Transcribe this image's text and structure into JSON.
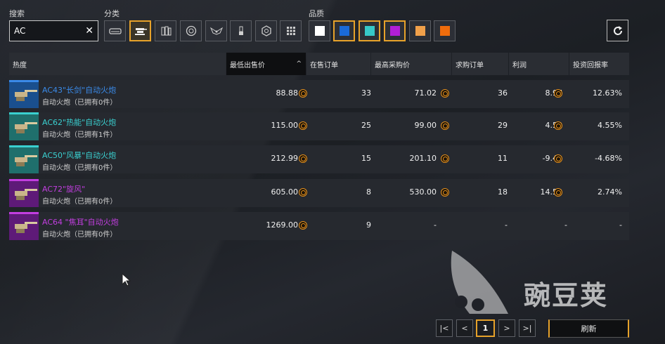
{
  "labels": {
    "search": "搜索",
    "category": "分类",
    "quality": "品质"
  },
  "search": {
    "value": "AC",
    "clear_icon": "close-icon"
  },
  "categories": [
    {
      "icon": "vehicle-icon",
      "active": false
    },
    {
      "icon": "autocannon-icon",
      "active": true
    },
    {
      "icon": "ammo-rack-icon",
      "active": false
    },
    {
      "icon": "wheel-icon",
      "active": false
    },
    {
      "icon": "wings-icon",
      "active": false
    },
    {
      "icon": "brush-icon",
      "active": false
    },
    {
      "icon": "module-icon",
      "active": false
    },
    {
      "icon": "grid-icon",
      "active": false
    }
  ],
  "qualities": [
    {
      "color": "#ffffff",
      "active": false
    },
    {
      "color": "#1a6ad8",
      "active": true
    },
    {
      "color": "#37c8c8",
      "active": true
    },
    {
      "color": "#b21ed6",
      "active": true
    },
    {
      "color": "#f0a04a",
      "active": false
    },
    {
      "color": "#ef6c0c",
      "active": false
    }
  ],
  "columns": [
    "热度",
    "最低出售价",
    "在售订单",
    "最高采购价",
    "求购订单",
    "利润",
    "投资回报率"
  ],
  "sort_indicator": "^",
  "rows": [
    {
      "name": "AC43\"长剑\"自动火炮",
      "sub": "自动火炮（已拥有0件）",
      "color": "#3a8ae8",
      "thumb": "#1a4f8e",
      "min_sell": "88.88",
      "on_sale": "33",
      "max_buy": "71.02",
      "buy_orders": "36",
      "profit": "8.97",
      "roi": "12.63%"
    },
    {
      "name": "AC62\"热能\"自动火炮",
      "sub": "自动火炮（已拥有1件）",
      "color": "#3ad0d0",
      "thumb": "#1f6f6c",
      "min_sell": "115.00",
      "on_sale": "25",
      "max_buy": "99.00",
      "buy_orders": "29",
      "profit": "4.50",
      "roi": "4.55%"
    },
    {
      "name": "AC50\"风暴\"自动火炮",
      "sub": "自动火炮（已拥有0件）",
      "color": "#3ad0d0",
      "thumb": "#1f6f6c",
      "min_sell": "212.99",
      "on_sale": "15",
      "max_buy": "201.10",
      "buy_orders": "11",
      "profit": "-9.41",
      "roi": "-4.68%"
    },
    {
      "name": "AC72\"旋风\"",
      "sub": "自动火炮（已拥有0件）",
      "color": "#c23ee0",
      "thumb": "#5e1a78",
      "min_sell": "605.00",
      "on_sale": "8",
      "max_buy": "530.00",
      "buy_orders": "18",
      "profit": "14.50",
      "roi": "2.74%"
    },
    {
      "name": "AC64 \"焦耳\"自动火炮",
      "sub": "自动火炮（已拥有0件）",
      "color": "#c23ee0",
      "thumb": "#5e1a78",
      "min_sell": "1269.00",
      "on_sale": "9",
      "max_buy": "-",
      "buy_orders": "-",
      "profit": "-",
      "roi": "-"
    }
  ],
  "pagination": {
    "first": "|<",
    "prev": "<",
    "current": "1",
    "next": ">",
    "last": ">|"
  },
  "refresh_label": "刷新",
  "watermark": "豌豆荚"
}
